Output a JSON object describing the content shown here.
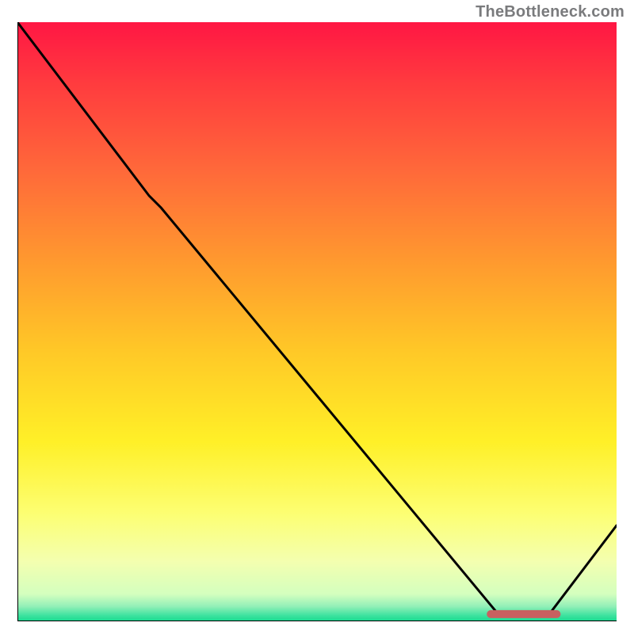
{
  "watermark": "TheBottleneck.com",
  "chart_data": {
    "type": "line",
    "title": "",
    "xlabel": "",
    "ylabel": "",
    "xlim": [
      0,
      100
    ],
    "ylim": [
      0,
      100
    ],
    "grid": false,
    "legend": false,
    "gradient_stops": [
      {
        "pos": 0.0,
        "color": "#ff1744"
      },
      {
        "pos": 0.1,
        "color": "#ff3b3f"
      },
      {
        "pos": 0.25,
        "color": "#ff6a3a"
      },
      {
        "pos": 0.4,
        "color": "#ff9a2f"
      },
      {
        "pos": 0.55,
        "color": "#ffc927"
      },
      {
        "pos": 0.7,
        "color": "#fff028"
      },
      {
        "pos": 0.82,
        "color": "#fdff73"
      },
      {
        "pos": 0.9,
        "color": "#f4ffb0"
      },
      {
        "pos": 0.955,
        "color": "#d4ffbf"
      },
      {
        "pos": 0.975,
        "color": "#93f0b8"
      },
      {
        "pos": 0.99,
        "color": "#3fe3a0"
      },
      {
        "pos": 1.0,
        "color": "#17d98f"
      }
    ],
    "curve_points": [
      {
        "x": 0,
        "y": 100
      },
      {
        "x": 22,
        "y": 71
      },
      {
        "x": 24,
        "y": 69
      },
      {
        "x": 80,
        "y": 1.5
      },
      {
        "x": 81,
        "y": 1.0
      },
      {
        "x": 88,
        "y": 1.0
      },
      {
        "x": 89,
        "y": 1.5
      },
      {
        "x": 100,
        "y": 16
      }
    ],
    "marker_segment": {
      "x_start": 79,
      "x_end": 90,
      "y": 1.2
    }
  }
}
